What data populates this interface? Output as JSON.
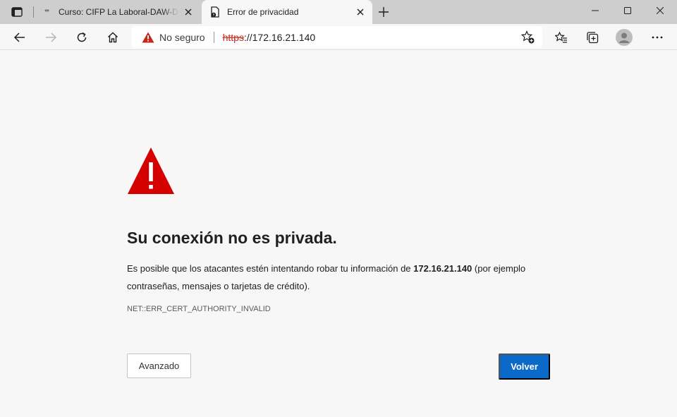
{
  "tabs": [
    {
      "favicon_text": "**",
      "label": "Curso: CIFP La Laboral-DAW-Des",
      "active": false
    },
    {
      "label": "Error de privacidad",
      "active": true
    }
  ],
  "address_bar": {
    "security_text": "No seguro",
    "url_scheme": "https",
    "url_rest": "://172.16.21.140"
  },
  "page": {
    "heading": "Su conexión no es privada.",
    "description_before": "Es posible que los atacantes estén intentando robar tu información de ",
    "host": "172.16.21.140",
    "description_after": " (por ejemplo contraseñas, mensajes o tarjetas de crédito).",
    "error_code": "NET::ERR_CERT_AUTHORITY_INVALID",
    "advanced_button": "Avanzado",
    "back_button": "Volver"
  },
  "colors": {
    "warning_red": "#d40000",
    "url_scheme_red": "#c5271d",
    "primary_button": "#0b6ac9",
    "page_background": "#f7f7f7",
    "tabstrip": "#cecece"
  },
  "icons": {
    "tab_actions": "tab-actions-icon",
    "tab_close": "close-icon",
    "new_tab": "plus-icon",
    "minimize": "minimize-icon",
    "maximize": "maximize-icon",
    "window_close": "close-icon",
    "back": "arrow-left-icon",
    "forward": "arrow-right-icon",
    "refresh": "refresh-icon",
    "home": "home-icon",
    "not_secure": "warning-triangle-icon",
    "add_favorite": "star-add-icon",
    "favorites": "favorites-icon",
    "collections": "collections-icon",
    "profile": "profile-icon",
    "menu": "more-icon"
  }
}
